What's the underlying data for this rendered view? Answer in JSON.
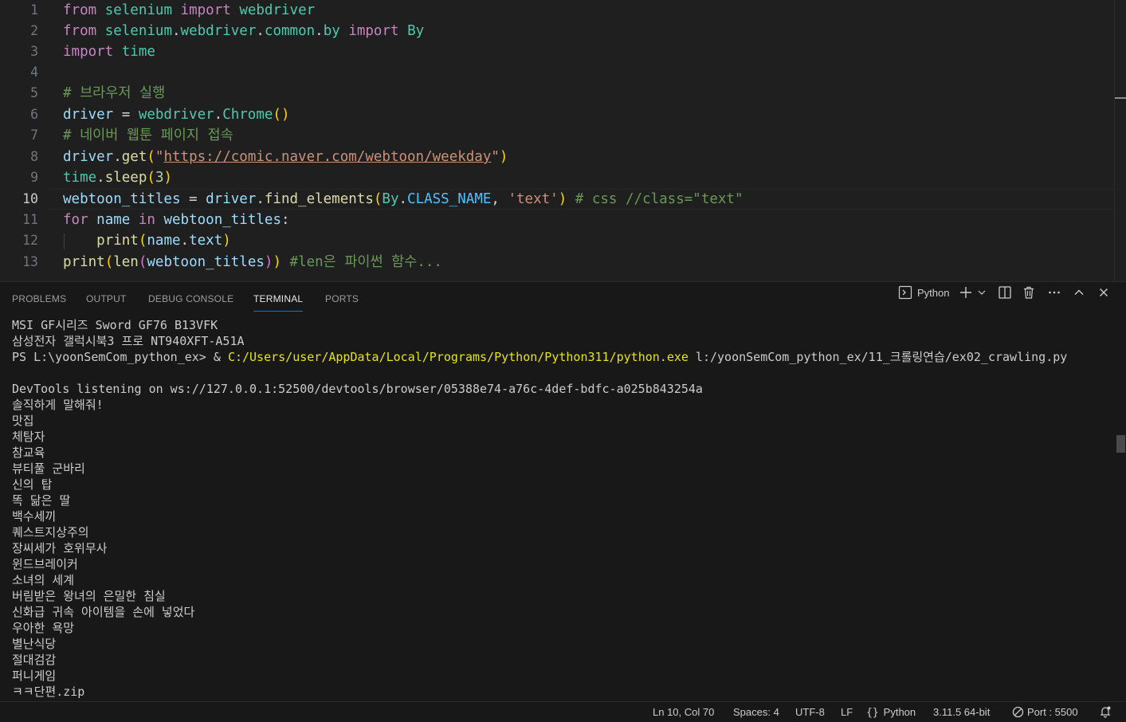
{
  "editor": {
    "active_line": 10,
    "lines": [
      {
        "n": "1"
      },
      {
        "n": "2"
      },
      {
        "n": "3"
      },
      {
        "n": "4"
      },
      {
        "n": "5"
      },
      {
        "n": "6"
      },
      {
        "n": "7"
      },
      {
        "n": "8"
      },
      {
        "n": "9"
      },
      {
        "n": "10"
      },
      {
        "n": "11"
      },
      {
        "n": "12"
      },
      {
        "n": "13"
      }
    ],
    "tokens": {
      "l1": [
        "from",
        "selenium",
        "import",
        "webdriver"
      ],
      "l2": [
        "from",
        "selenium",
        "webdriver",
        "common",
        "by",
        "import",
        "By"
      ],
      "l3": [
        "import",
        "time"
      ],
      "l5": "# 브라우저 실행",
      "l6": [
        "driver",
        "webdriver",
        "Chrome"
      ],
      "l7": "# 네이버 웹툰 페이지 접속",
      "l8": [
        "driver",
        "get",
        "\"",
        "https://comic.naver.com/webtoon/weekday",
        "\""
      ],
      "l9": [
        "time",
        "sleep",
        "3"
      ],
      "l10": [
        "webtoon_titles",
        "driver",
        "find_elements",
        "By",
        "CLASS_NAME",
        "'text'",
        "# css //class=\"text\""
      ],
      "l11": [
        "for",
        "name",
        "in",
        "webtoon_titles"
      ],
      "l12": [
        "print",
        "name",
        "text"
      ],
      "l13": [
        "print",
        "len",
        "webtoon_titles",
        "#len은 파이썬 함수..."
      ]
    }
  },
  "panel": {
    "tabs": [
      "PROBLEMS",
      "OUTPUT",
      "DEBUG CONSOLE",
      "TERMINAL",
      "PORTS"
    ],
    "active_tab": "TERMINAL",
    "terminal_name": "Python"
  },
  "terminal": {
    "header_lines": [
      "MSI GF시리즈 Sword GF76 B13VFK",
      "삼성전자 갤럭시북3 프로 NT940XFT-A51A"
    ],
    "prompt": "PS L:\\yoonSemCom_python_ex> & ",
    "exe": "C:/Users/user/AppData/Local/Programs/Python/Python311/python.exe",
    "script": " l:/yoonSemCom_python_ex/11_크롤링연습/ex02_crawling.py",
    "devtools": "DevTools listening on ws://127.0.0.1:52500/devtools/browser/05388e74-a76c-4def-bdfc-a025b843254a",
    "titles": [
      "솔직하게 말해줘!",
      "맛집",
      "체탐자",
      "참교육",
      "뷰티풀 군바리",
      "신의 탑",
      "똑 닮은 딸",
      "백수세끼",
      "퀘스트지상주의",
      "장씨세가 호위무사",
      "윈드브레이커",
      "소녀의 세계",
      "버림받은 왕녀의 은밀한 침실",
      "신화급 귀속 아이템을 손에 넣었다",
      "우아한 욕망",
      "별난식당",
      "절대검감",
      "퍼니게임",
      "ㅋㅋ단편.zip"
    ]
  },
  "statusbar": {
    "position": "Ln 10, Col 70",
    "spaces": "Spaces: 4",
    "encoding": "UTF-8",
    "eol": "LF",
    "language": "Python",
    "interpreter": "3.11.5 64-bit",
    "port": "Port : 5500"
  },
  "colors": {
    "editor_bg": "#1f1f1f",
    "panel_bg": "#181818",
    "accent": "#0078d4",
    "terminal_yellow": "#e5e510"
  }
}
